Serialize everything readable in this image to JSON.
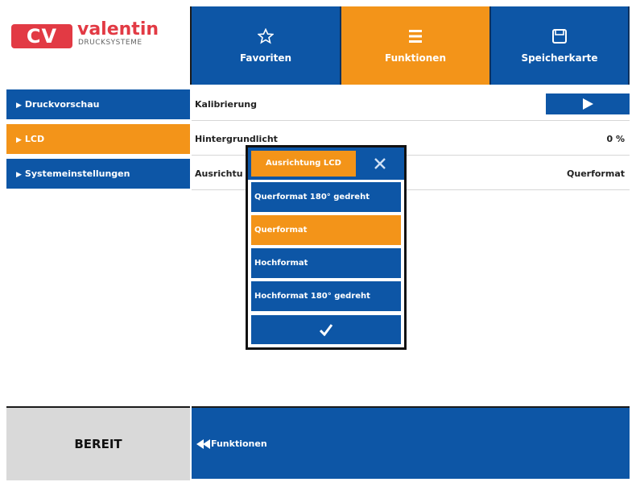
{
  "logo": {
    "mark": "CV",
    "name": "valentin",
    "sub": "DRUCKSYSTEME"
  },
  "nav": [
    {
      "label": "Favoriten",
      "icon": "star-icon",
      "active": false
    },
    {
      "label": "Funktionen",
      "icon": "list-icon",
      "active": true
    },
    {
      "label": "Speicherkarte",
      "icon": "save-icon",
      "active": false
    }
  ],
  "sidebar": {
    "items": [
      {
        "label": "Druckvorschau",
        "active": false
      },
      {
        "label": "LCD",
        "active": true
      },
      {
        "label": "Systemeinstellungen",
        "active": false
      }
    ]
  },
  "rows": [
    {
      "label": "Kalibrierung",
      "value": ""
    },
    {
      "label": "Hintergrundlicht",
      "value": "0 %"
    },
    {
      "label": "Ausrichtu",
      "value": "Querformat"
    }
  ],
  "dialog": {
    "title": "Ausrichtung LCD",
    "options": [
      {
        "label": "Querformat 180° gedreht",
        "active": false
      },
      {
        "label": "Querformat",
        "active": true
      },
      {
        "label": "Hochformat",
        "active": false
      },
      {
        "label": "Hochformat 180° gedreht",
        "active": false
      }
    ]
  },
  "status": {
    "text": "BEREIT"
  },
  "footer": {
    "back_label": "Funktionen"
  },
  "colors": {
    "blue": "#0d56a6",
    "orange": "#f39419",
    "brand_red": "#e23a44"
  }
}
